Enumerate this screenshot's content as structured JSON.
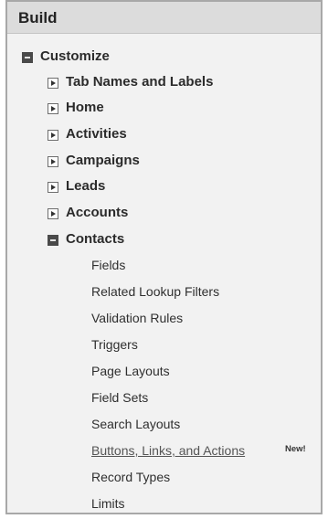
{
  "panel": {
    "title": "Build"
  },
  "customize": {
    "label": "Customize"
  },
  "items": [
    {
      "label": "Tab Names and Labels"
    },
    {
      "label": "Home"
    },
    {
      "label": "Activities"
    },
    {
      "label": "Campaigns"
    },
    {
      "label": "Leads"
    },
    {
      "label": "Accounts"
    }
  ],
  "contacts": {
    "label": "Contacts",
    "children": [
      {
        "label": "Fields"
      },
      {
        "label": "Related Lookup Filters"
      },
      {
        "label": "Validation Rules"
      },
      {
        "label": "Triggers"
      },
      {
        "label": "Page Layouts"
      },
      {
        "label": "Field Sets"
      },
      {
        "label": "Search Layouts"
      },
      {
        "label": "Buttons, Links, and Actions",
        "badge": "New!"
      },
      {
        "label": "Record Types"
      },
      {
        "label": "Limits"
      }
    ]
  }
}
